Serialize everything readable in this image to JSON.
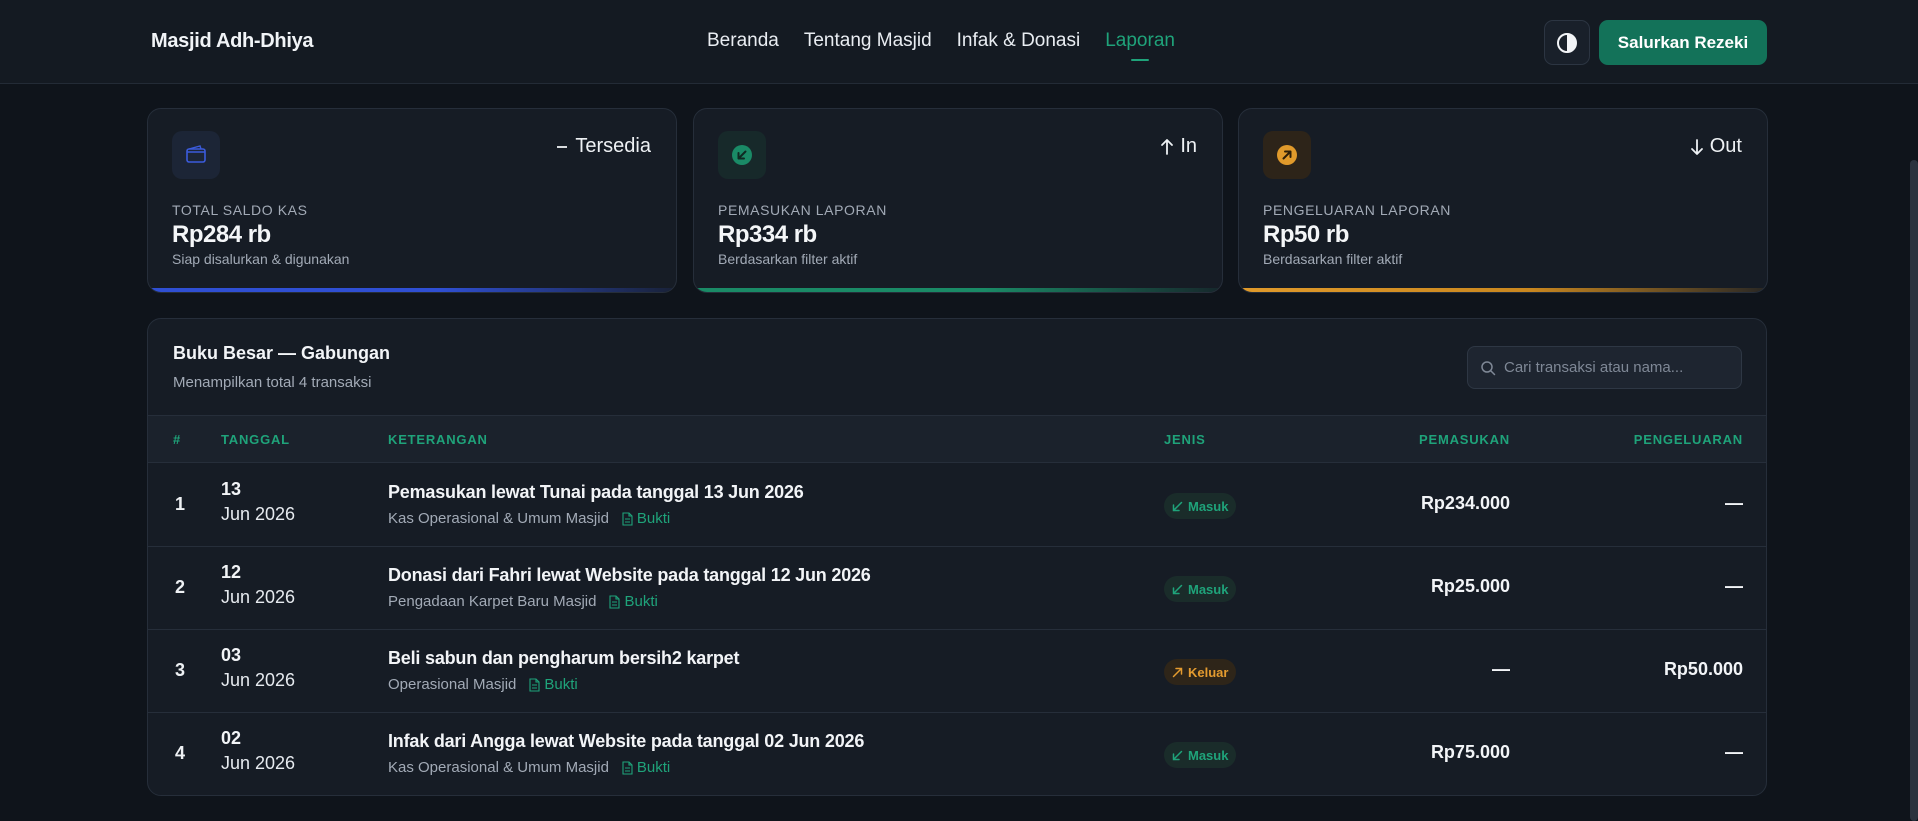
{
  "header": {
    "brand": "Masjid Adh-Dhiya",
    "nav": [
      {
        "label": "Beranda",
        "active": false
      },
      {
        "label": "Tentang Masjid",
        "active": false
      },
      {
        "label": "Infak & Donasi",
        "active": false
      },
      {
        "label": "Laporan",
        "active": true
      }
    ],
    "theme_toggle_icon": "contrast-icon",
    "cta_label": "Salurkan Rezeki"
  },
  "stats": [
    {
      "icon": "wallet-icon",
      "trend_icon": "minus-icon",
      "trend": "Tersedia",
      "label": "TOTAL SALDO KAS",
      "value": "Rp284 rb",
      "sub": "Siap disalurkan & digunakan",
      "accent": "#3b5bdb"
    },
    {
      "icon": "arrow-down-left-icon",
      "trend_icon": "arrow-up-icon",
      "trend": "In",
      "label": "PEMASUKAN LAPORAN",
      "value": "Rp334 rb",
      "sub": "Berdasarkan filter aktif",
      "accent": "#1a8a66"
    },
    {
      "icon": "arrow-up-right-icon",
      "trend_icon": "arrow-down-icon",
      "trend": "Out",
      "label": "PENGELUARAN LAPORAN",
      "value": "Rp50 rb",
      "sub": "Berdasarkan filter aktif",
      "accent": "#e09a2b"
    }
  ],
  "ledger": {
    "title": "Buku Besar — Gabungan",
    "subtitle": "Menampilkan total 4 transaksi",
    "search_placeholder": "Cari transaksi atau nama...",
    "columns": {
      "num": "#",
      "date": "TANGGAL",
      "desc": "KETERANGAN",
      "type": "JENIS",
      "income": "PEMASUKAN",
      "expense": "PENGELUARAN"
    },
    "proof_label": "Bukti",
    "rows": [
      {
        "num": "1",
        "day": "13",
        "month": "Jun 2026",
        "desc": "Pemasukan lewat Tunai pada tanggal 13 Jun 2026",
        "category": "Kas Operasional & Umum Masjid",
        "type": "Masuk",
        "kind": "in",
        "income": "Rp234.000",
        "expense": "—"
      },
      {
        "num": "2",
        "day": "12",
        "month": "Jun 2026",
        "desc": "Donasi dari Fahri lewat Website pada tanggal 12 Jun 2026",
        "category": "Pengadaan Karpet Baru Masjid",
        "type": "Masuk",
        "kind": "in",
        "income": "Rp25.000",
        "expense": "—"
      },
      {
        "num": "3",
        "day": "03",
        "month": "Jun 2026",
        "desc": "Beli sabun dan pengharum bersih2 karpet",
        "category": "Operasional Masjid",
        "type": "Keluar",
        "kind": "out",
        "income": "—",
        "expense": "Rp50.000"
      },
      {
        "num": "4",
        "day": "02",
        "month": "Jun 2026",
        "desc": "Infak dari Angga lewat Website pada tanggal 02 Jun 2026",
        "category": "Kas Operasional & Umum Masjid",
        "type": "Masuk",
        "kind": "in",
        "income": "Rp75.000",
        "expense": "—"
      }
    ]
  },
  "colors": {
    "accent_green": "#1fa37a",
    "accent_orange": "#e49b2f",
    "accent_blue": "#3b5bdb",
    "cta_bg": "#137259"
  }
}
